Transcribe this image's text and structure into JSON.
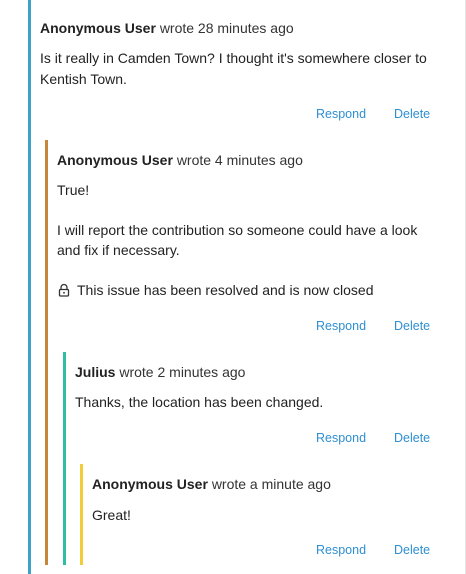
{
  "comments": [
    {
      "author": "Anonymous User",
      "meta": "wrote 28 minutes ago",
      "lines": [
        "Is it really in Camden Town? I thought it's somewhere closer to",
        "Kentish Town."
      ],
      "respond": "Respond",
      "delete": "Delete"
    },
    {
      "author": "Anonymous User",
      "meta": "wrote 4 minutes ago",
      "lines": [
        "True!",
        "I will report the contribution so someone could have a look",
        "and fix if necessary."
      ],
      "status": "This issue has been resolved and is now closed",
      "respond": "Respond",
      "delete": "Delete"
    },
    {
      "author": "Julius",
      "meta": "wrote 2 minutes ago",
      "lines": [
        "Thanks, the location has been changed."
      ],
      "respond": "Respond",
      "delete": "Delete"
    },
    {
      "author": "Anonymous User",
      "meta": "wrote a minute ago",
      "lines": [
        "Great!"
      ],
      "respond": "Respond",
      "delete": "Delete"
    }
  ],
  "colors": {
    "thread_level_1": "#3fa0c8",
    "thread_level_2": "#c7873a",
    "thread_level_3": "#2fbea4",
    "thread_level_4": "#f2cd37",
    "link": "#2e8fd1"
  },
  "icons": {
    "status": "lock-icon"
  }
}
